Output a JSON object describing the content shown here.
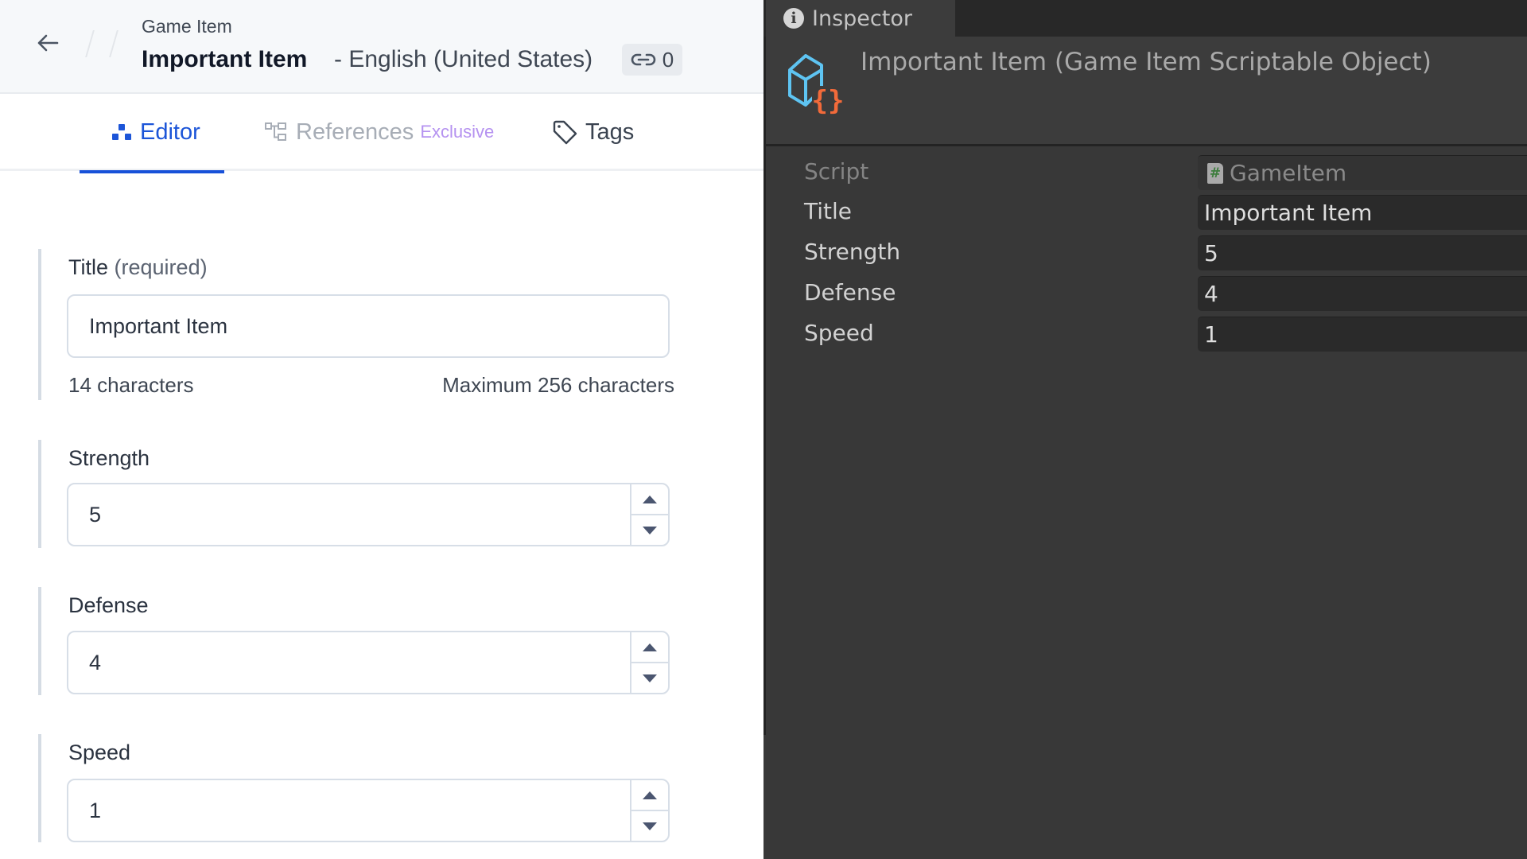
{
  "editor": {
    "header": {
      "back_label": "Back",
      "breadcrumb": "Game Item",
      "title": "Important Item",
      "locale": "- English (United States)",
      "references_count": "0"
    },
    "tabs": [
      {
        "label": "Editor",
        "icon": "editor-icon",
        "active": true
      },
      {
        "label": "References",
        "badge": "Exclusive",
        "icon": "references-icon",
        "disabled": true
      },
      {
        "label": "Tags",
        "icon": "tag-icon"
      }
    ],
    "fields": {
      "title": {
        "label": "Title",
        "qualifier": "(required)",
        "value": "Important Item",
        "char_count": "14 characters",
        "char_max": "Maximum 256 characters"
      },
      "strength": {
        "label": "Strength",
        "value": "5"
      },
      "defense": {
        "label": "Defense",
        "value": "4"
      },
      "speed": {
        "label": "Speed",
        "value": "1"
      }
    },
    "colors": {
      "accent": "#1751d9",
      "badge_exclusive": "#b592f0"
    }
  },
  "inspector": {
    "tab_label": "Inspector",
    "object_title": "Important Item (Game Item Scriptable Object)",
    "properties": [
      {
        "label": "Script",
        "value": "GameItem",
        "readonly": true
      },
      {
        "label": "Title",
        "value": "Important Item"
      },
      {
        "label": "Strength",
        "value": "5"
      },
      {
        "label": "Defense",
        "value": "4"
      },
      {
        "label": "Speed",
        "value": "1"
      }
    ],
    "colors": {
      "icon_cube": "#5ec4f2",
      "icon_braces": "#f26a3a",
      "background": "#383838"
    }
  }
}
